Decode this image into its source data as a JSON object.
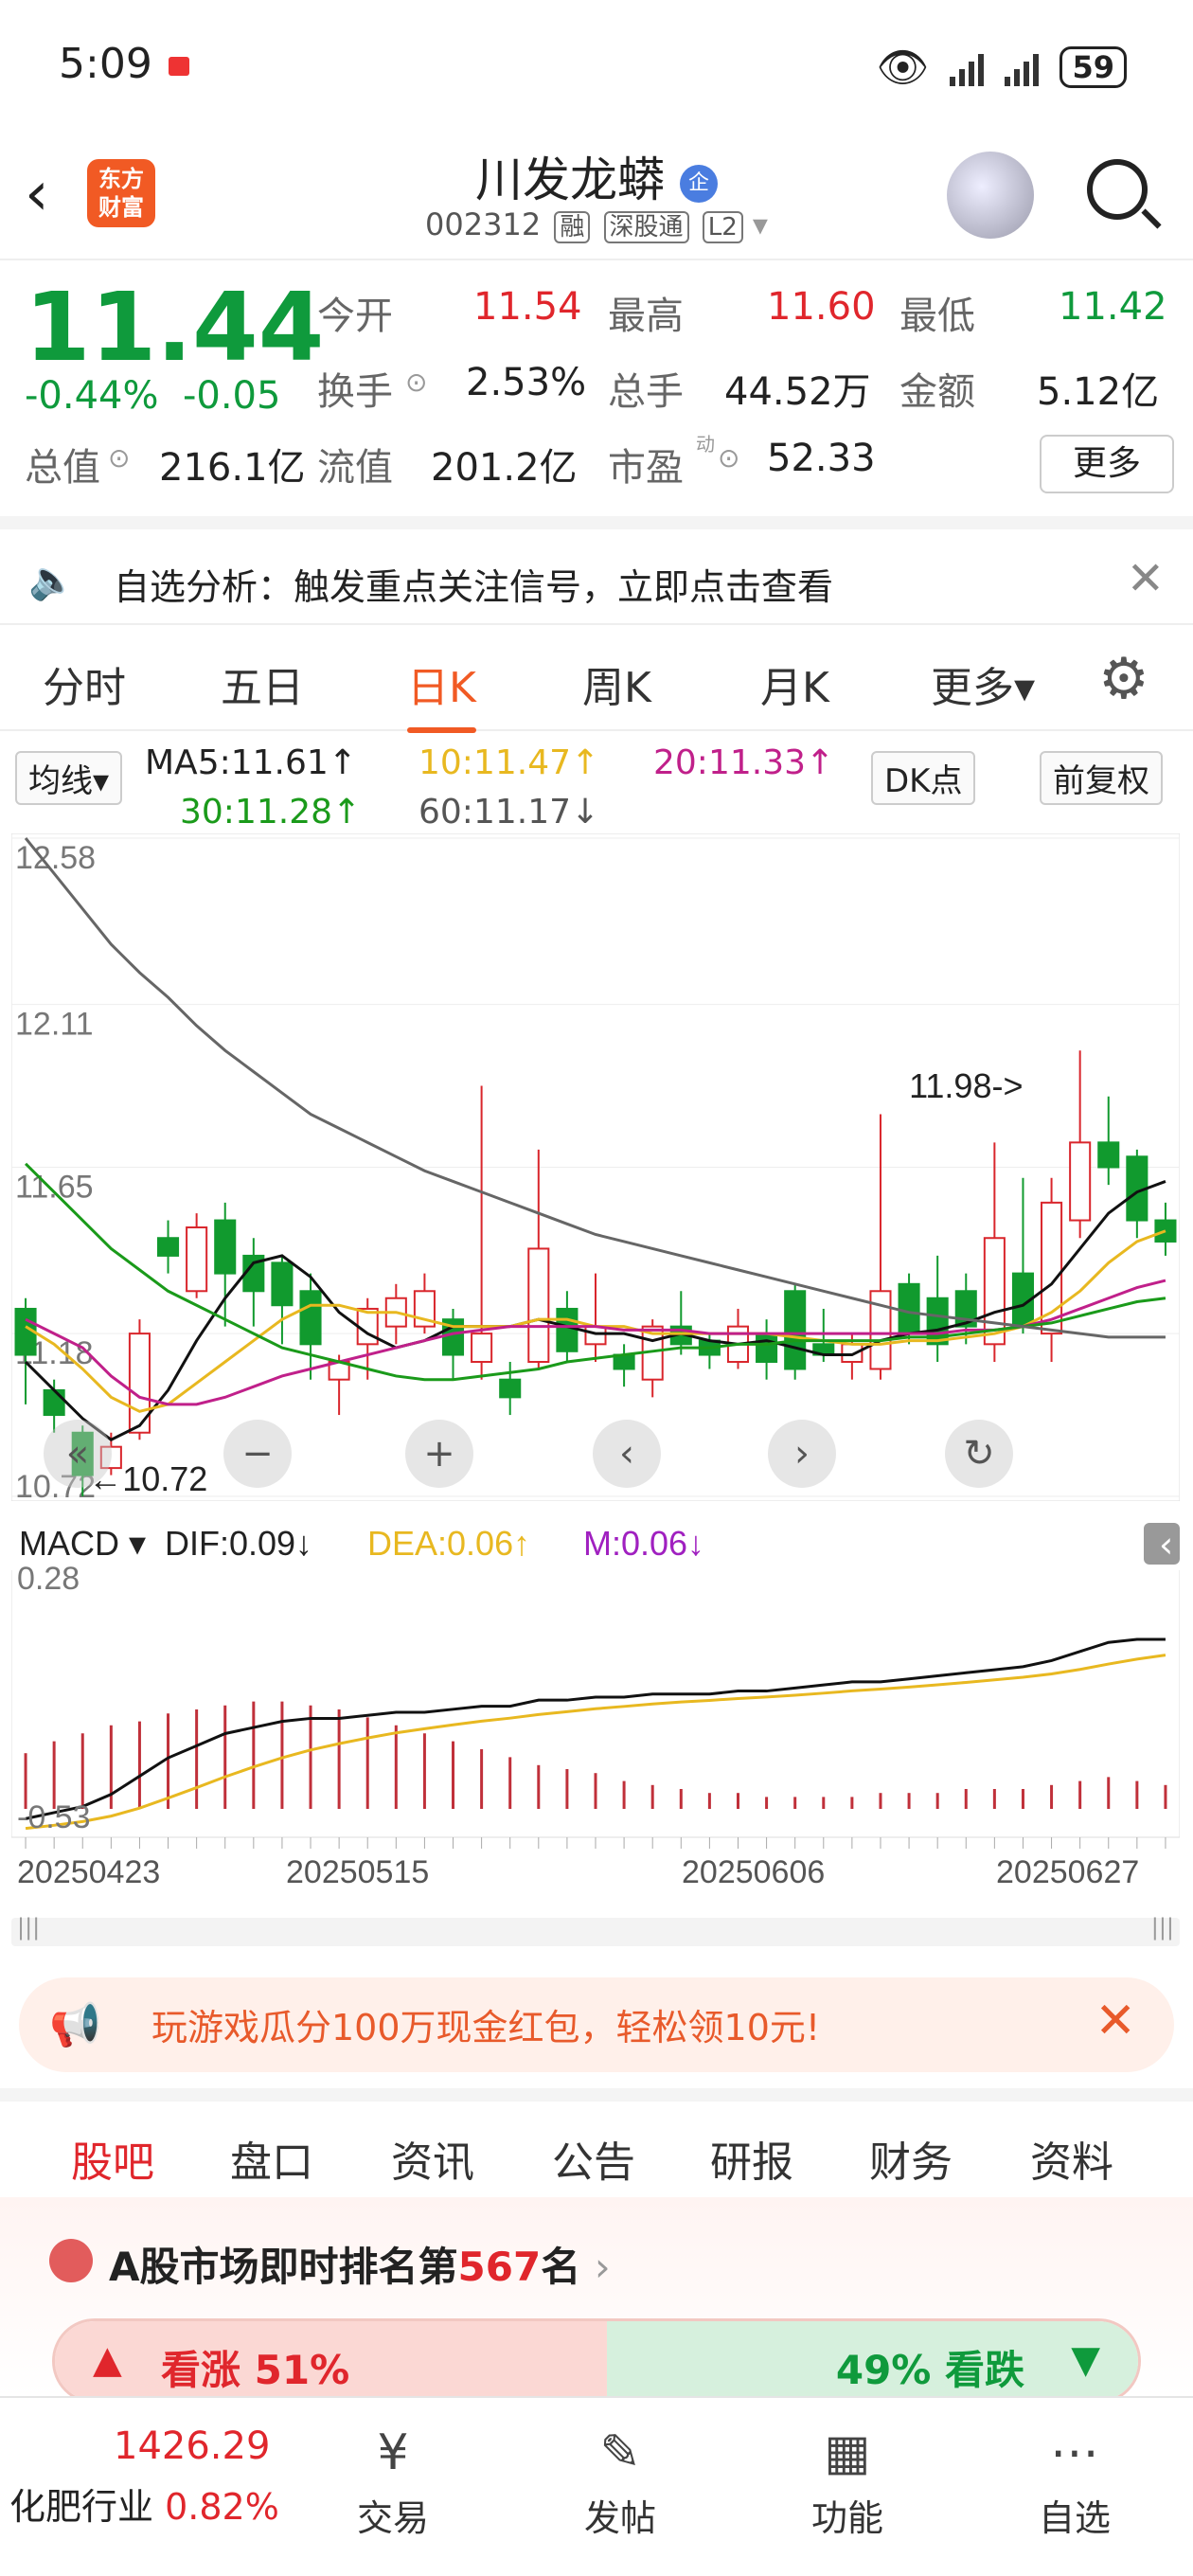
{
  "status_bar": {
    "time": "5:09",
    "battery": "59"
  },
  "header": {
    "title": "川发龙蟒",
    "badge": "企",
    "code": "002312",
    "tags": [
      "融",
      "深股通",
      "L2"
    ],
    "logo_line1": "东方",
    "logo_line2": "财富"
  },
  "quote": {
    "price": "11.44",
    "change_pct": "-0.44%",
    "change_abs": "-0.05",
    "open_label": "今开",
    "open": "11.54",
    "high_label": "最高",
    "high": "11.60",
    "low_label": "最低",
    "low": "11.42",
    "turnover_label": "换手",
    "turnover": "2.53%",
    "volume_label": "总手",
    "volume": "44.52万",
    "amount_label": "金额",
    "amount": "5.12亿",
    "mktcap_label": "总值",
    "mktcap": "216.1亿",
    "float_label": "流值",
    "float": "201.2亿",
    "pe_label": "市盈",
    "pe_sup": "动",
    "pe": "52.33",
    "more": "更多"
  },
  "alert": {
    "text": "自选分析：触发重点关注信号，立即点击查看"
  },
  "period_tabs": {
    "items": [
      "分时",
      "五日",
      "日K",
      "周K",
      "月K",
      "更多▾"
    ],
    "active": 2
  },
  "ma": {
    "selector": "均线▾",
    "ma5": "MA5:11.61↑",
    "ma10": "10:11.47↑",
    "ma20": "20:11.33↑",
    "ma30": "30:11.28↑",
    "ma60": "60:11.17↓",
    "dk": "DK点",
    "adj": "前复权"
  },
  "chart_data": [
    {
      "type": "candlestick",
      "y_ticks": [
        "12.58",
        "12.11",
        "11.65",
        "11.18",
        "10.72"
      ],
      "ylim": [
        10.72,
        12.58
      ],
      "x_ticks": [
        "20250423",
        "20250515",
        "20250606",
        "20250627"
      ],
      "annotations": {
        "high": "11.98->",
        "low": "←10.72"
      },
      "candles": [
        {
          "o": 11.25,
          "c": 11.12,
          "h": 11.28,
          "l": 10.98
        },
        {
          "o": 11.02,
          "c": 10.95,
          "h": 11.05,
          "l": 10.9
        },
        {
          "o": 10.9,
          "c": 10.78,
          "h": 10.92,
          "l": 10.72
        },
        {
          "o": 10.8,
          "c": 10.86,
          "h": 10.9,
          "l": 10.78
        },
        {
          "o": 10.9,
          "c": 11.18,
          "h": 11.22,
          "l": 10.88
        },
        {
          "o": 11.45,
          "c": 11.4,
          "h": 11.5,
          "l": 11.35
        },
        {
          "o": 11.3,
          "c": 11.48,
          "h": 11.52,
          "l": 11.28
        },
        {
          "o": 11.5,
          "c": 11.35,
          "h": 11.55,
          "l": 11.2
        },
        {
          "o": 11.4,
          "c": 11.3,
          "h": 11.45,
          "l": 11.2
        },
        {
          "o": 11.38,
          "c": 11.26,
          "h": 11.4,
          "l": 11.15
        },
        {
          "o": 11.3,
          "c": 11.15,
          "h": 11.35,
          "l": 11.05
        },
        {
          "o": 11.05,
          "c": 11.1,
          "h": 11.12,
          "l": 10.95
        },
        {
          "o": 11.15,
          "c": 11.25,
          "h": 11.28,
          "l": 11.05
        },
        {
          "o": 11.2,
          "c": 11.28,
          "h": 11.32,
          "l": 11.15
        },
        {
          "o": 11.2,
          "c": 11.3,
          "h": 11.35,
          "l": 11.18
        },
        {
          "o": 11.22,
          "c": 11.12,
          "h": 11.25,
          "l": 11.05
        },
        {
          "o": 11.1,
          "c": 11.18,
          "h": 11.88,
          "l": 11.05
        },
        {
          "o": 11.05,
          "c": 11.0,
          "h": 11.1,
          "l": 10.95
        },
        {
          "o": 11.1,
          "c": 11.42,
          "h": 11.7,
          "l": 11.08
        },
        {
          "o": 11.25,
          "c": 11.13,
          "h": 11.3,
          "l": 11.1
        },
        {
          "o": 11.15,
          "c": 11.2,
          "h": 11.35,
          "l": 11.1
        },
        {
          "o": 11.12,
          "c": 11.08,
          "h": 11.15,
          "l": 11.03
        },
        {
          "o": 11.05,
          "c": 11.2,
          "h": 11.22,
          "l": 11.0
        },
        {
          "o": 11.2,
          "c": 11.15,
          "h": 11.3,
          "l": 11.12
        },
        {
          "o": 11.16,
          "c": 11.12,
          "h": 11.18,
          "l": 11.08
        },
        {
          "o": 11.1,
          "c": 11.2,
          "h": 11.25,
          "l": 11.08
        },
        {
          "o": 11.18,
          "c": 11.1,
          "h": 11.22,
          "l": 11.05
        },
        {
          "o": 11.3,
          "c": 11.08,
          "h": 11.32,
          "l": 11.05
        },
        {
          "o": 11.15,
          "c": 11.12,
          "h": 11.25,
          "l": 11.1
        },
        {
          "o": 11.1,
          "c": 11.15,
          "h": 11.18,
          "l": 11.05
        },
        {
          "o": 11.08,
          "c": 11.3,
          "h": 11.8,
          "l": 11.05
        },
        {
          "o": 11.32,
          "c": 11.18,
          "h": 11.35,
          "l": 11.15
        },
        {
          "o": 11.28,
          "c": 11.15,
          "h": 11.4,
          "l": 11.1
        },
        {
          "o": 11.3,
          "c": 11.2,
          "h": 11.35,
          "l": 11.15
        },
        {
          "o": 11.15,
          "c": 11.45,
          "h": 11.72,
          "l": 11.1
        },
        {
          "o": 11.35,
          "c": 11.2,
          "h": 11.62,
          "l": 11.18
        },
        {
          "o": 11.18,
          "c": 11.55,
          "h": 11.62,
          "l": 11.1
        },
        {
          "o": 11.5,
          "c": 11.72,
          "h": 11.98,
          "l": 11.45
        },
        {
          "o": 11.72,
          "c": 11.65,
          "h": 11.85,
          "l": 11.6
        },
        {
          "o": 11.68,
          "c": 11.5,
          "h": 11.7,
          "l": 11.45
        },
        {
          "o": 11.5,
          "c": 11.44,
          "h": 11.55,
          "l": 11.4
        }
      ],
      "ma": [
        {
          "name": "MA5",
          "color": "#111111",
          "values": [
            11.1,
            11.02,
            10.94,
            10.88,
            10.92,
            11.02,
            11.16,
            11.28,
            11.38,
            11.4,
            11.34,
            11.24,
            11.18,
            11.14,
            11.16,
            11.2,
            11.2,
            11.2,
            11.22,
            11.2,
            11.18,
            11.18,
            11.16,
            11.18,
            11.16,
            11.15,
            11.16,
            11.14,
            11.12,
            11.12,
            11.16,
            11.18,
            11.19,
            11.21,
            11.24,
            11.26,
            11.32,
            11.42,
            11.52,
            11.58,
            11.61
          ]
        },
        {
          "name": "10",
          "color": "#e8b820",
          "values": [
            11.2,
            11.15,
            11.08,
            11.0,
            10.96,
            10.98,
            11.04,
            11.1,
            11.16,
            11.22,
            11.26,
            11.26,
            11.24,
            11.24,
            11.22,
            11.2,
            11.2,
            11.2,
            11.22,
            11.22,
            11.2,
            11.2,
            11.18,
            11.18,
            11.18,
            11.18,
            11.18,
            11.17,
            11.16,
            11.15,
            11.15,
            11.16,
            11.16,
            11.17,
            11.18,
            11.2,
            11.24,
            11.3,
            11.38,
            11.44,
            11.47
          ]
        },
        {
          "name": "20",
          "color": "#c0208a",
          "values": [
            11.22,
            11.18,
            11.14,
            11.06,
            11.0,
            10.98,
            10.98,
            11.0,
            11.03,
            11.06,
            11.08,
            11.1,
            11.12,
            11.14,
            11.16,
            11.18,
            11.19,
            11.2,
            11.2,
            11.2,
            11.2,
            11.19,
            11.19,
            11.19,
            11.18,
            11.18,
            11.18,
            11.18,
            11.18,
            11.18,
            11.18,
            11.18,
            11.18,
            11.19,
            11.19,
            11.2,
            11.22,
            11.25,
            11.28,
            11.31,
            11.33
          ]
        },
        {
          "name": "30",
          "color": "#1a9a1a",
          "values": [
            11.66,
            11.58,
            11.5,
            11.42,
            11.36,
            11.3,
            11.26,
            11.22,
            11.18,
            11.14,
            11.12,
            11.1,
            11.08,
            11.06,
            11.05,
            11.05,
            11.06,
            11.07,
            11.08,
            11.1,
            11.11,
            11.12,
            11.13,
            11.14,
            11.14,
            11.15,
            11.15,
            11.16,
            11.16,
            11.16,
            11.16,
            11.17,
            11.17,
            11.18,
            11.19,
            11.2,
            11.21,
            11.23,
            11.25,
            11.27,
            11.28
          ]
        },
        {
          "name": "60",
          "color": "#666666",
          "values": [
            12.58,
            12.48,
            12.38,
            12.28,
            12.2,
            12.13,
            12.05,
            11.98,
            11.92,
            11.86,
            11.8,
            11.76,
            11.72,
            11.68,
            11.64,
            11.61,
            11.58,
            11.55,
            11.52,
            11.49,
            11.46,
            11.44,
            11.42,
            11.4,
            11.38,
            11.36,
            11.34,
            11.32,
            11.3,
            11.28,
            11.26,
            11.24,
            11.23,
            11.22,
            11.21,
            11.2,
            11.19,
            11.18,
            11.17,
            11.17,
            11.17
          ]
        }
      ]
    },
    {
      "type": "bar",
      "title": "MACD",
      "dif_label": "DIF:0.09↓",
      "dea_label": "DEA:0.06↑",
      "m_label": "M:0.06↓",
      "y_ticks": [
        "0.28",
        "-0.53"
      ],
      "ylim": [
        -0.53,
        0.28
      ],
      "macd": [
        0.14,
        0.17,
        0.19,
        0.21,
        0.22,
        0.24,
        0.25,
        0.26,
        0.27,
        0.27,
        0.26,
        0.25,
        0.23,
        0.21,
        0.19,
        0.17,
        0.15,
        0.13,
        0.11,
        0.1,
        0.09,
        0.07,
        0.06,
        0.05,
        0.04,
        0.04,
        0.03,
        0.03,
        0.03,
        0.03,
        0.04,
        0.04,
        0.04,
        0.05,
        0.05,
        0.05,
        0.06,
        0.07,
        0.08,
        0.07,
        0.06
      ],
      "dif": [
        -0.5,
        -0.48,
        -0.46,
        -0.42,
        -0.36,
        -0.3,
        -0.26,
        -0.22,
        -0.2,
        -0.18,
        -0.17,
        -0.17,
        -0.16,
        -0.15,
        -0.15,
        -0.14,
        -0.13,
        -0.13,
        -0.11,
        -0.11,
        -0.1,
        -0.1,
        -0.09,
        -0.09,
        -0.09,
        -0.08,
        -0.08,
        -0.07,
        -0.06,
        -0.05,
        -0.05,
        -0.04,
        -0.03,
        -0.02,
        -0.01,
        0.0,
        0.02,
        0.05,
        0.08,
        0.09,
        0.09
      ]
    }
  ],
  "overlay_buttons": [
    "«",
    "−",
    "+",
    "‹",
    "›",
    "↻"
  ],
  "promo": {
    "text": "玩游戏瓜分100万现金红包，轻松领10元!"
  },
  "content_tabs": {
    "items": [
      "股吧",
      "盘口",
      "资讯",
      "公告",
      "研报",
      "财务",
      "资料"
    ],
    "active": 0
  },
  "ranking": {
    "prefix": "A股市场即时排名第",
    "rank": "567",
    "suffix": "名",
    "up": "看涨 51%",
    "down": "49% 看跌",
    "up_pct": 51
  },
  "bottom_nav": {
    "index_value": "1426.29",
    "index_name": "化肥行业",
    "index_chg": "0.82%",
    "items": [
      "交易",
      "发帖",
      "功能",
      "自选"
    ]
  }
}
